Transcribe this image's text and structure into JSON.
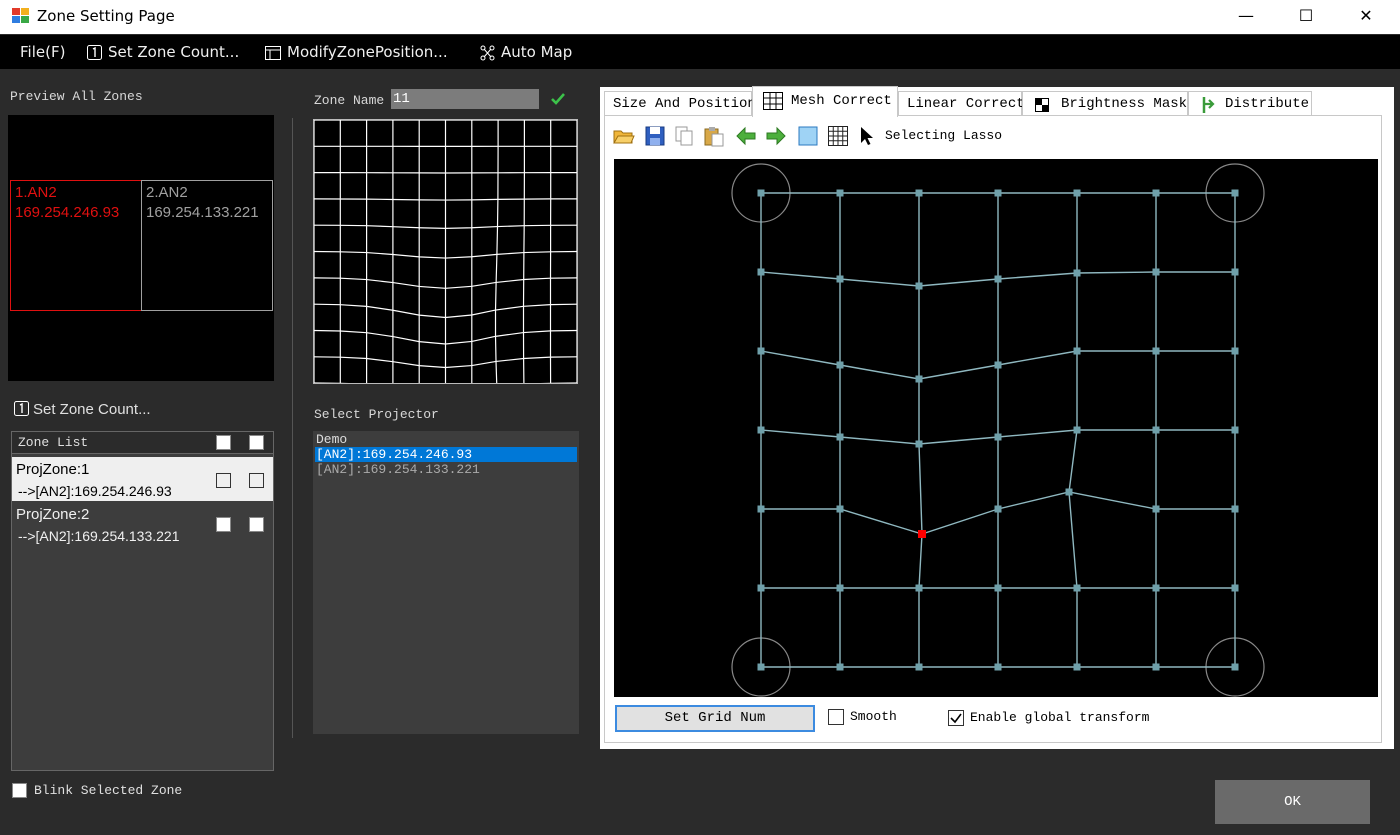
{
  "window": {
    "title": "Zone Setting Page",
    "minimize": "—",
    "maximize": "☐",
    "close": "✕"
  },
  "menu": {
    "file": "File(F)",
    "set_zone_count": "Set Zone Count...",
    "modify_zone_position": "ModifyZonePosition...",
    "auto_map": "Auto Map"
  },
  "left": {
    "preview_label": "Preview All Zones",
    "zones": [
      {
        "name": "1.AN2",
        "ip": "169.254.246.93",
        "color": "#e01010"
      },
      {
        "name": "2.AN2",
        "ip": "169.254.133.221",
        "color": "#a0a0a0"
      }
    ],
    "set_zone_count_label": "Set Zone Count...",
    "zone_list_header": "Zone List",
    "zone_list": [
      {
        "name": "ProjZone:1",
        "target": "-->[AN2]:169.254.246.93"
      },
      {
        "name": "ProjZone:2",
        "target": "-->[AN2]:169.254.133.221"
      }
    ],
    "blink_label": "Blink Selected Zone"
  },
  "middle": {
    "zone_name_label": "Zone Name",
    "zone_name_value": "11",
    "select_projector_label": "Select Projector",
    "projectors": [
      "Demo",
      "[AN2]:169.254.246.93",
      "[AN2]:169.254.133.221"
    ],
    "selected_projector_index": 1
  },
  "tabs": [
    "Size And Position",
    "Mesh Correct",
    "Linear Correct",
    "Brightness Mask",
    "Distribute"
  ],
  "active_tab": "Mesh Correct",
  "toolbar": {
    "mode_label": "Selecting Lasso"
  },
  "mesh_controls": {
    "set_grid_button": "Set Grid Num",
    "smooth_label": "Smooth",
    "smooth_checked": false,
    "global_transform_label": "Enable global transform",
    "global_transform_checked": true
  },
  "ok_button": "OK",
  "colors": {
    "accent": "#0078d7",
    "selected_point": "#ff0000",
    "grid_line": "#8fb8c0",
    "active_zone": "#e01010"
  }
}
